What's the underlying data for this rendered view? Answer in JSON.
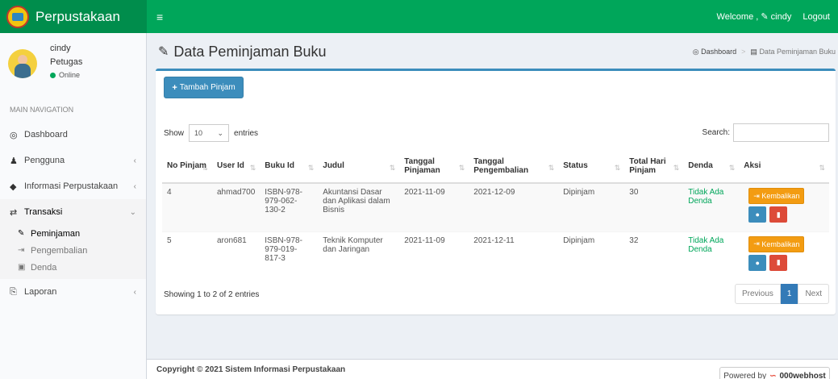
{
  "app": {
    "title": "Perpustakaan"
  },
  "navbar": {
    "menu_icon": "≡",
    "welcome": "Welcome ,",
    "user": "cindy",
    "logout": "Logout"
  },
  "sidebar": {
    "user_name": "cindy",
    "user_role": "Petugas",
    "status": "Online",
    "nav_header": "MAIN NAVIGATION",
    "items": [
      {
        "label": "Dashboard",
        "icon": "dashboard-icon"
      },
      {
        "label": "Pengguna",
        "icon": "user-icon"
      },
      {
        "label": "Informasi Perpustakaan",
        "icon": "tag-icon"
      },
      {
        "label": "Transaksi",
        "icon": "exchange-icon"
      },
      {
        "label": "Laporan",
        "icon": "report-icon"
      }
    ],
    "submenu": [
      {
        "label": "Peminjaman",
        "icon": "edit-icon"
      },
      {
        "label": "Pengembalian",
        "icon": "sign-in-icon"
      },
      {
        "label": "Denda",
        "icon": "money-icon"
      }
    ]
  },
  "header": {
    "title": "Data Peminjaman Buku"
  },
  "breadcrumb": {
    "home": "Dashboard",
    "current": "Data Peminjaman Buku"
  },
  "box": {
    "add_button": "Tambah Pinjam",
    "show_label": "Show",
    "show_value": "10",
    "entries_label": "entries",
    "search_label": "Search:",
    "search_value": ""
  },
  "table": {
    "columns": [
      "No Pinjam",
      "User Id",
      "Buku Id",
      "Judul",
      "Tanggal Pinjaman",
      "Tanggal Pengembalian",
      "Status",
      "Total Hari Pinjam",
      "Denda",
      "Aksi"
    ],
    "rows": [
      {
        "no": "4",
        "user": "ahmad700",
        "buku": "ISBN-978-979-062-130-2",
        "judul": "Akuntansi Dasar dan Aplikasi dalam Bisnis",
        "tgl_pinjam": "2021-11-09",
        "tgl_kembali": "2021-12-09",
        "status": "Dipinjam",
        "hari": "30",
        "denda": "Tidak Ada Denda",
        "action": "Kembalikan"
      },
      {
        "no": "5",
        "user": "aron681",
        "buku": "ISBN-978-979-019-817-3",
        "judul": "Teknik Komputer dan Jaringan",
        "tgl_pinjam": "2021-11-09",
        "tgl_kembali": "2021-12-11",
        "status": "Dipinjam",
        "hari": "32",
        "denda": "Tidak Ada Denda",
        "action": "Kembalikan"
      }
    ]
  },
  "pagination": {
    "info": "Showing 1 to 2 of 2 entries",
    "previous": "Previous",
    "current": "1",
    "next": "Next"
  },
  "footer": {
    "copyright": "Copyright © 2021 Sistem Informasi Perpustakaan",
    "powered_prefix": "Powered by",
    "powered_brand": "000webhost"
  },
  "colors": {
    "green": "#00a65a",
    "primary": "#3c8dbc",
    "warning": "#f39c12",
    "danger": "#dd4b39"
  }
}
